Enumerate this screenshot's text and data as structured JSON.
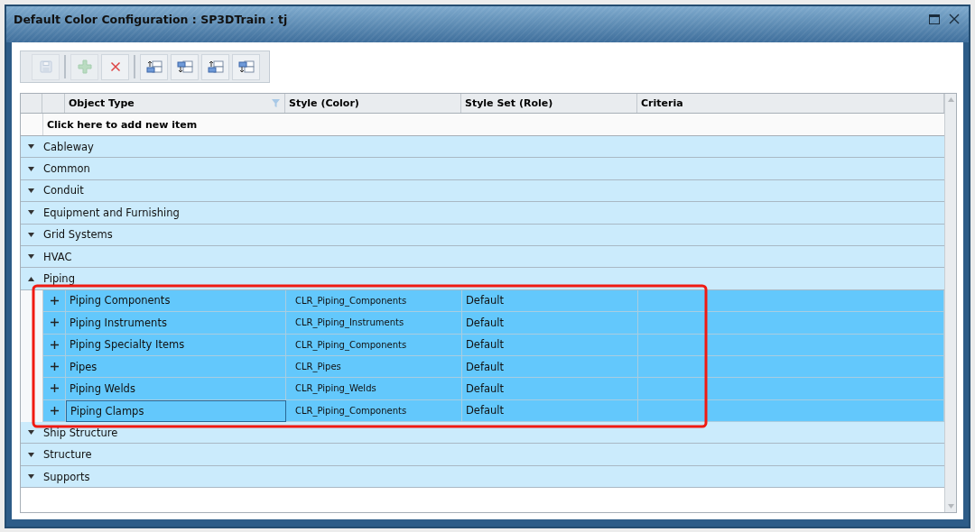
{
  "window": {
    "title": "Default Color Configuration : SP3DTrain : tj"
  },
  "toolbar": [
    {
      "kind": "save",
      "disabled": true
    },
    {
      "kind": "add",
      "disabled": true
    },
    {
      "kind": "delete",
      "disabled": false
    },
    {
      "kind": "move-up",
      "disabled": false
    },
    {
      "kind": "move-down",
      "disabled": false
    },
    {
      "kind": "move-top",
      "disabled": false
    },
    {
      "kind": "move-bottom",
      "disabled": false
    }
  ],
  "table": {
    "columns": [
      "Object Type",
      "Style (Color)",
      "Style Set (Role)",
      "Criteria"
    ],
    "add_row": "Click here to add new item",
    "groups": [
      {
        "name": "Cableway",
        "expanded": false
      },
      {
        "name": "Common",
        "expanded": false
      },
      {
        "name": "Conduit",
        "expanded": false
      },
      {
        "name": "Equipment and Furnishing",
        "expanded": false
      },
      {
        "name": "Grid Systems",
        "expanded": false
      },
      {
        "name": "HVAC",
        "expanded": false
      },
      {
        "name": "Piping",
        "expanded": true,
        "children": [
          {
            "object_type": "Piping Components",
            "style": "CLR_Piping_Components",
            "style_set": "Default",
            "selected": true,
            "focused": false
          },
          {
            "object_type": "Piping Instruments",
            "style": "CLR_Piping_Instruments",
            "style_set": "Default",
            "selected": true,
            "focused": false
          },
          {
            "object_type": "Piping Specialty Items",
            "style": "CLR_Piping_Components",
            "style_set": "Default",
            "selected": true,
            "focused": false
          },
          {
            "object_type": "Pipes",
            "style": "CLR_Pipes",
            "style_set": "Default",
            "selected": true,
            "focused": false
          },
          {
            "object_type": "Piping Welds",
            "style": "CLR_Piping_Welds",
            "style_set": "Default",
            "selected": true,
            "focused": false
          },
          {
            "object_type": "Piping Clamps",
            "style": "CLR_Piping_Components",
            "style_set": "Default",
            "selected": true,
            "focused": true
          }
        ]
      },
      {
        "name": "Ship Structure",
        "expanded": false
      },
      {
        "name": "Structure",
        "expanded": false
      },
      {
        "name": "Supports",
        "expanded": false
      }
    ]
  }
}
